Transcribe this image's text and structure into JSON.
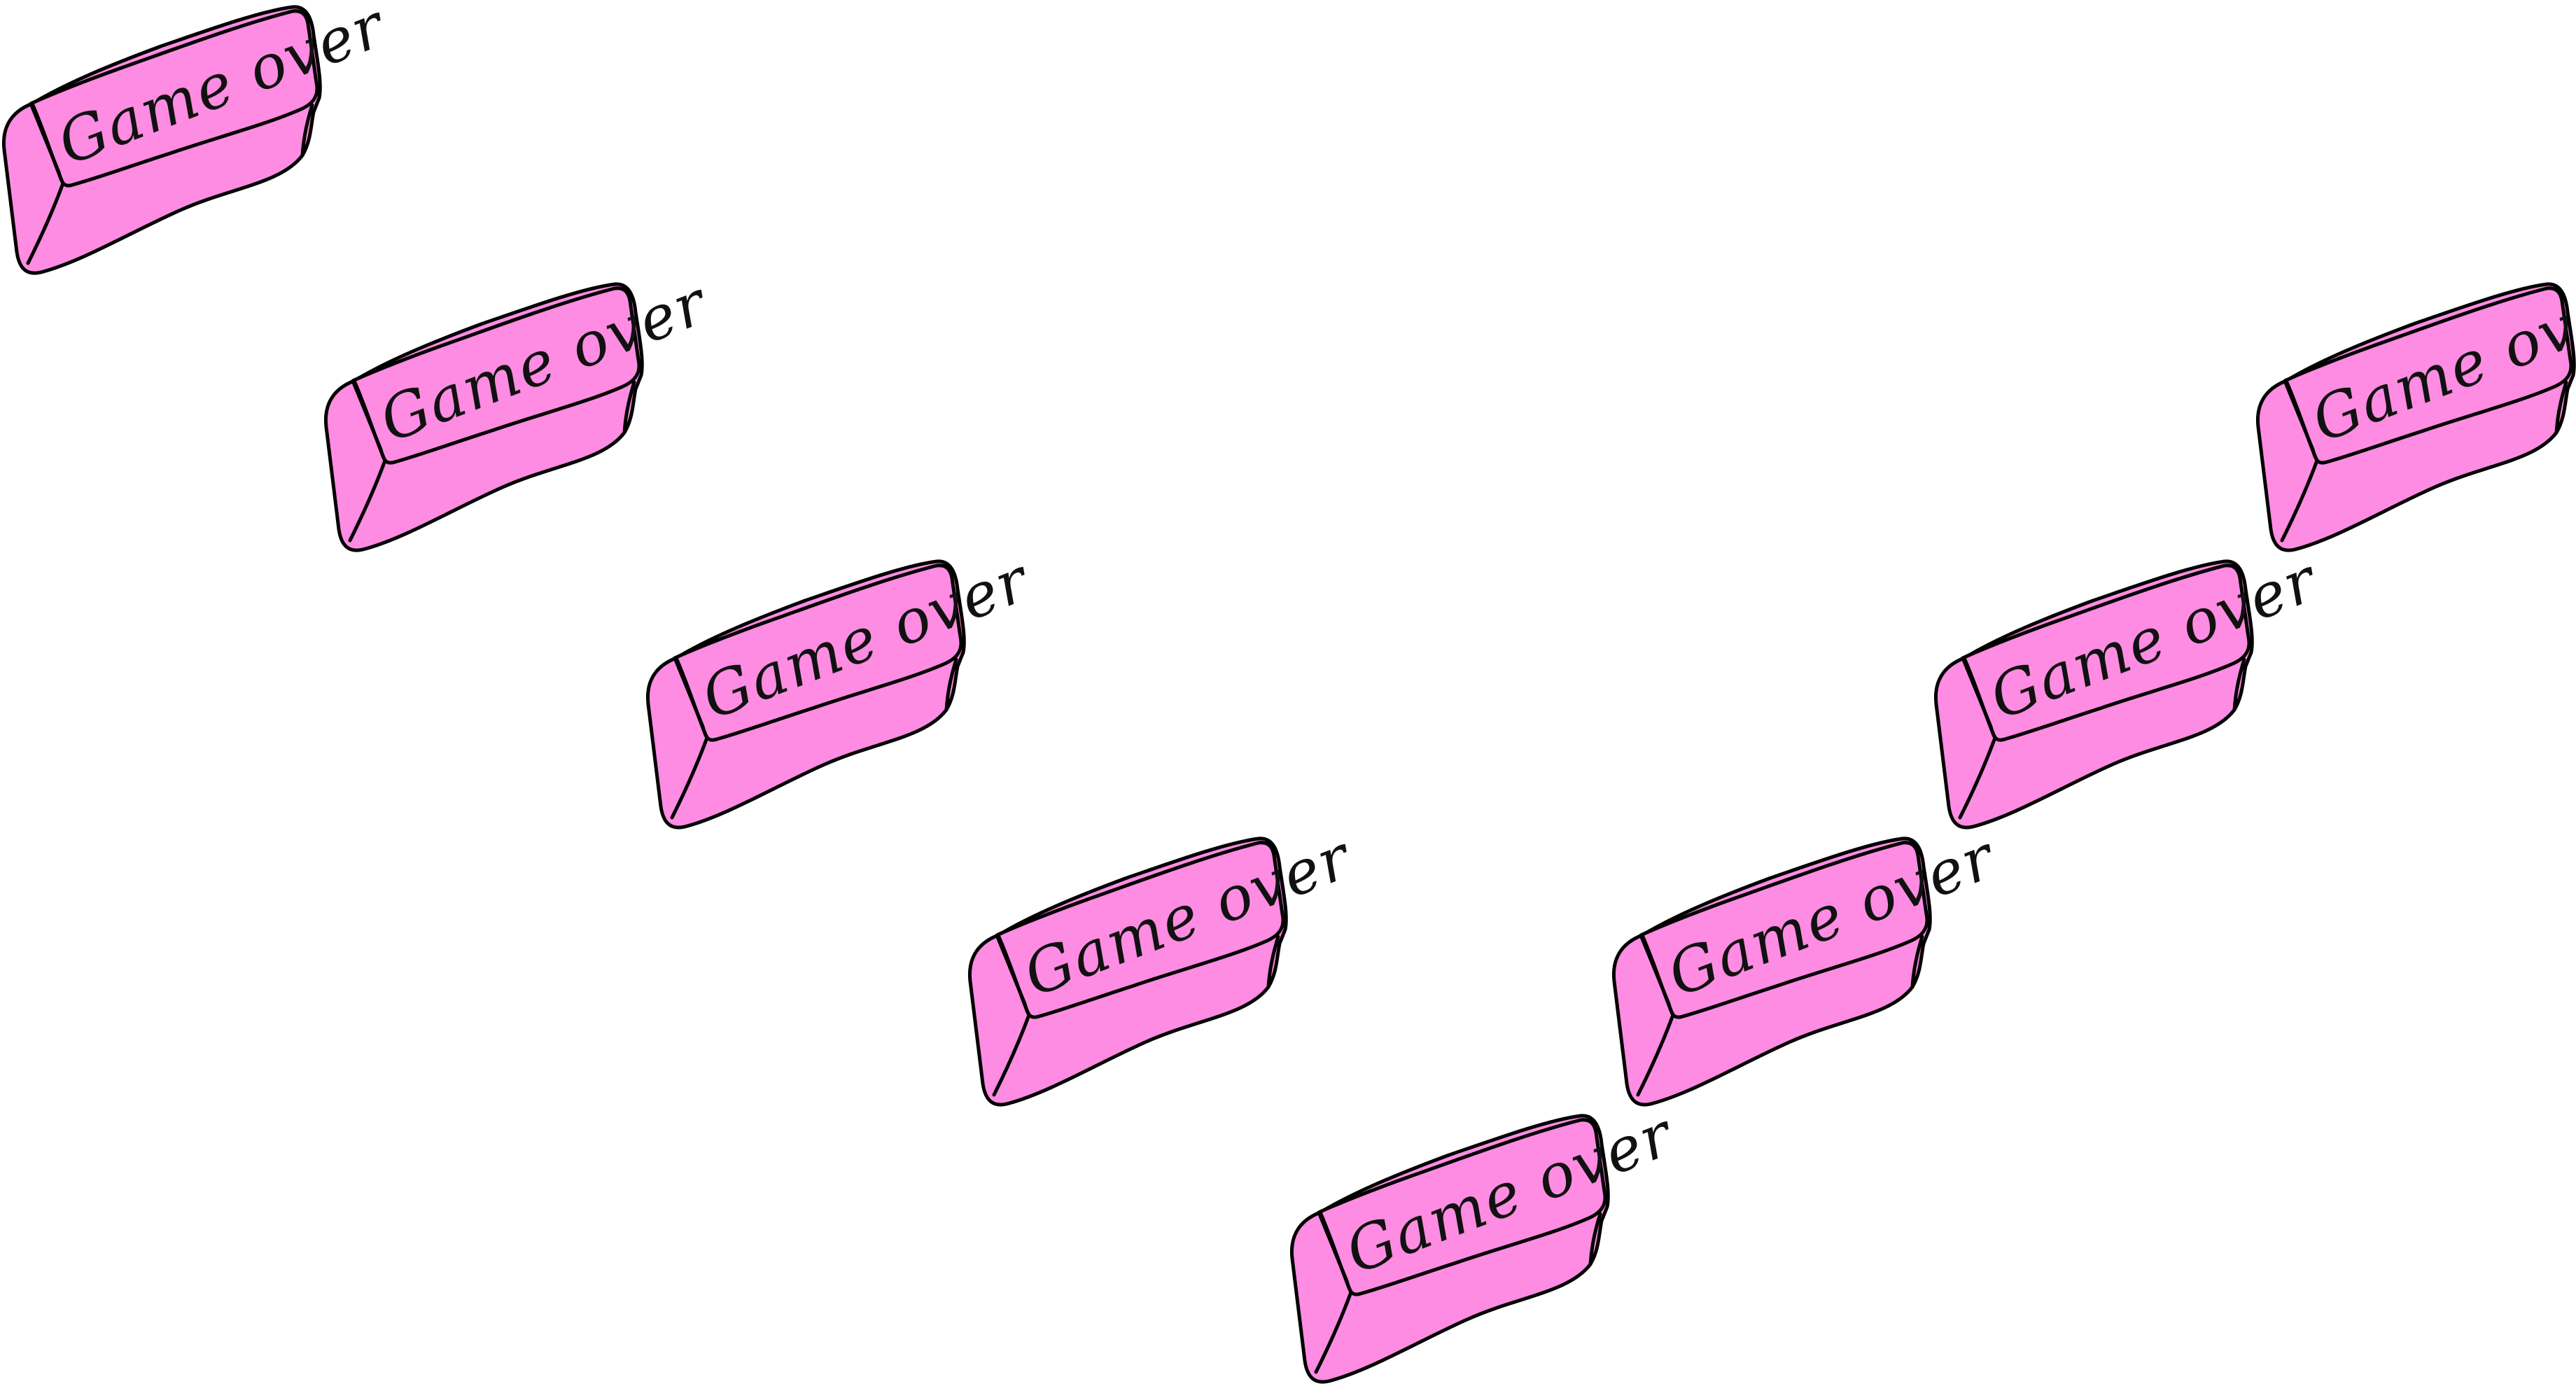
{
  "scene": {
    "background_color": "#ffffff",
    "eraser_fill": "#fe8ce2",
    "eraser_outline": "#000000",
    "label_color": "#111111"
  },
  "erasers": [
    {
      "label": "Game over"
    },
    {
      "label": "Game over"
    },
    {
      "label": "Game over"
    },
    {
      "label": "Game over"
    },
    {
      "label": "Game over"
    },
    {
      "label": "Game over"
    },
    {
      "label": "Game over"
    },
    {
      "label": "Game over"
    }
  ]
}
